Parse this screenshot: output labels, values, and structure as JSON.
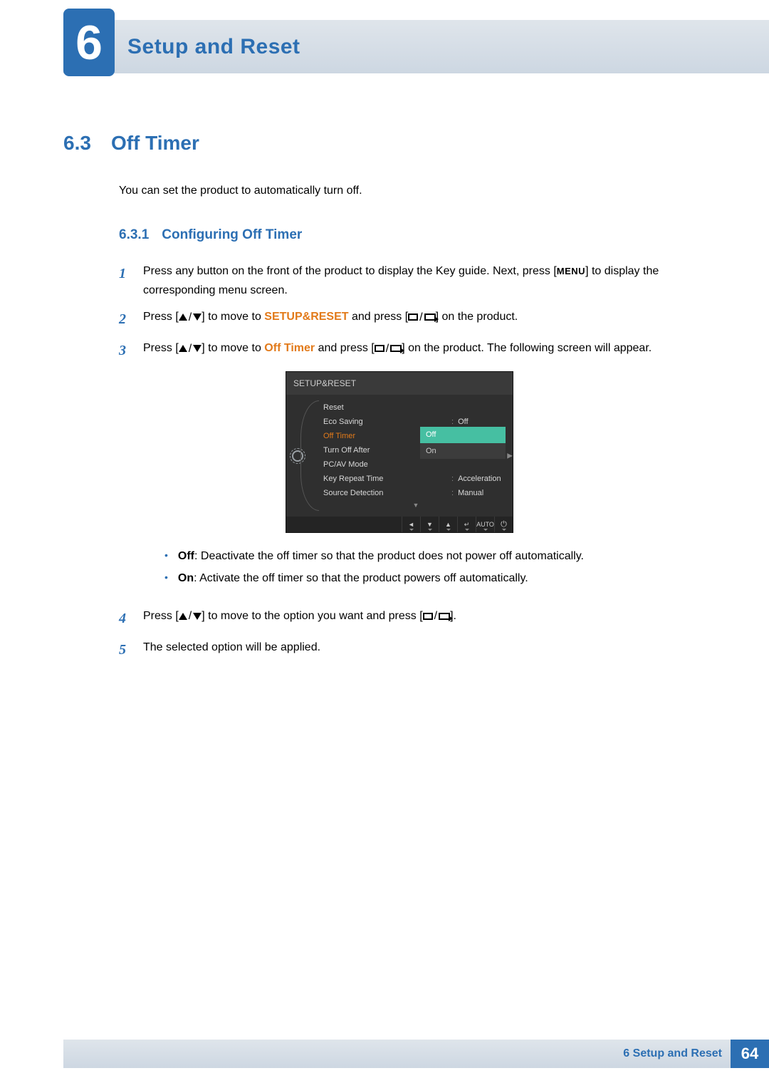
{
  "chapter": {
    "number": "6",
    "title": "Setup and Reset"
  },
  "section": {
    "number": "6.3",
    "title": "Off Timer",
    "intro": "You can set the product to automatically turn off."
  },
  "subsection": {
    "number": "6.3.1",
    "title": "Configuring Off Timer"
  },
  "steps": {
    "s1_a": "Press any button on the front of the product to display the Key guide. Next, press [",
    "s1_menu": "MENU",
    "s1_b": "] to display the corresponding menu screen.",
    "s2_a": "Press [",
    "s2_b": "] to move to ",
    "s2_mid_em": "SETUP&RESET",
    "s2_c": " and press [",
    "s2_d": "] on the product.",
    "s3_a": "Press [",
    "s3_b": "] to move to ",
    "s3_mid_em": "Off Timer",
    "s3_c": " and press [",
    "s3_d": "] on the product. The following screen will appear.",
    "s4_a": "Press [",
    "s4_b": "] to move to the option you want and press [",
    "s4_c": "].",
    "s5": "The selected option will be applied."
  },
  "step_numbers": {
    "n1": "1",
    "n2": "2",
    "n3": "3",
    "n4": "4",
    "n5": "5"
  },
  "bullets": {
    "off_label": "Off",
    "off_text": ": Deactivate the off timer so that the product does not power off automatically.",
    "on_label": "On",
    "on_text": ": Activate the off timer so that the product powers off automatically."
  },
  "osd": {
    "title": "SETUP&RESET",
    "items": {
      "reset": "Reset",
      "eco_saving": "Eco Saving",
      "off_timer": "Off Timer",
      "turn_off_after": "Turn Off After",
      "pc_av_mode": "PC/AV Mode",
      "key_repeat": "Key Repeat Time",
      "source_detect": "Source Detection"
    },
    "values": {
      "eco_saving": "Off",
      "off_timer_sel_off": "Off",
      "off_timer_sel_on": "On",
      "key_repeat": "Acceleration",
      "source_detect": "Manual"
    },
    "nav": {
      "auto": "AUTO"
    }
  },
  "footer": {
    "label": "6 Setup and Reset",
    "page": "64"
  }
}
